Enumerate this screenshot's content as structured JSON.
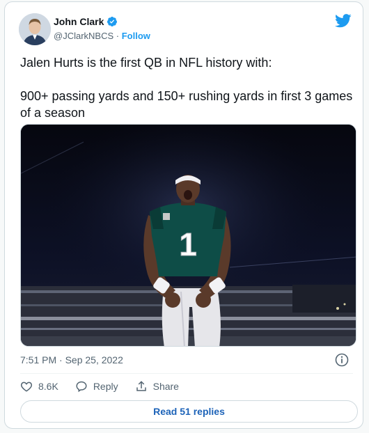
{
  "author": {
    "name": "John Clark",
    "handle": "@JClarkNBCS",
    "separator": " · ",
    "follow_label": "Follow"
  },
  "tweet": {
    "line1": "Jalen Hurts is the first QB in NFL history with:",
    "line2": "900+ passing yards and 150+ rushing yards in first 3 games of a season",
    "timestamp": "7:51 PM · Sep 25, 2022"
  },
  "photo": {
    "jersey_number": "1"
  },
  "actions": {
    "likes": "8.6K",
    "reply_label": "Reply",
    "share_label": "Share"
  },
  "read_replies_label": "Read 51 replies",
  "colors": {
    "brand_blue": "#1d9bf0",
    "text": "#0f1419",
    "muted": "#536471",
    "jersey_green": "#0e4d47"
  }
}
